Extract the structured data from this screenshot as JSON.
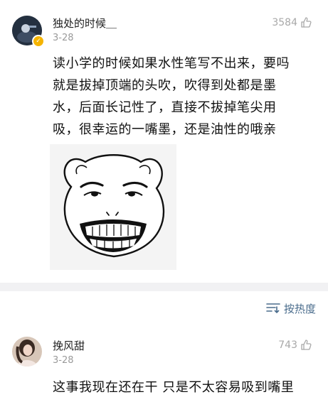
{
  "comments": [
    {
      "username": "独处的时候＿",
      "date": "3-28",
      "likes": "3584",
      "verified": true,
      "text_lines": [
        "读小学的时候如果水性笔写不出来，要吗",
        "就是拔掉顶端的头吹，吹得到处都是墨",
        "水，后面长记性了，直接不拔掉笔尖用",
        "吸，很幸运的一嘴墨，还是油性的哦亲"
      ]
    },
    {
      "username": "挽风甜",
      "date": "3-28",
      "likes": "743",
      "text_lines": [
        "这事我现在还在干 只是不太容易吸到嘴里"
      ]
    }
  ],
  "sort": {
    "label": "按热度",
    "icon": "sort-lines-icon"
  },
  "colors": {
    "link": "#4a6c8c",
    "muted": "#9a9a9a",
    "divider": "#f1f1f3",
    "verified": "#f5b400"
  }
}
